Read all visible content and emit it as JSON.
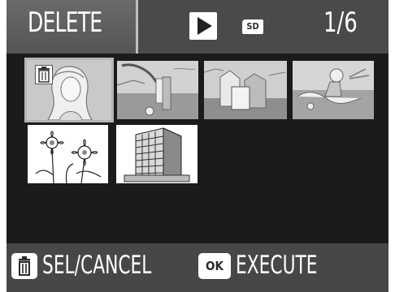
{
  "header": {
    "mode_label": "DELETE",
    "playback_icon": "play-icon",
    "media_badge": "SD",
    "counter": "1/6"
  },
  "thumbnails": [
    {
      "subject": "portrait",
      "selected": true,
      "mark": "trash-icon"
    },
    {
      "subject": "seaside",
      "selected": false
    },
    {
      "subject": "harbor",
      "selected": false
    },
    {
      "subject": "beach",
      "selected": false
    },
    {
      "subject": "flowers",
      "selected": false
    },
    {
      "subject": "building",
      "selected": false
    }
  ],
  "footer": {
    "sel_icon": "trash-button-icon",
    "sel_label": "SEL/CANCEL",
    "ok_icon_text": "OK",
    "execute_label": "EXECUTE"
  }
}
